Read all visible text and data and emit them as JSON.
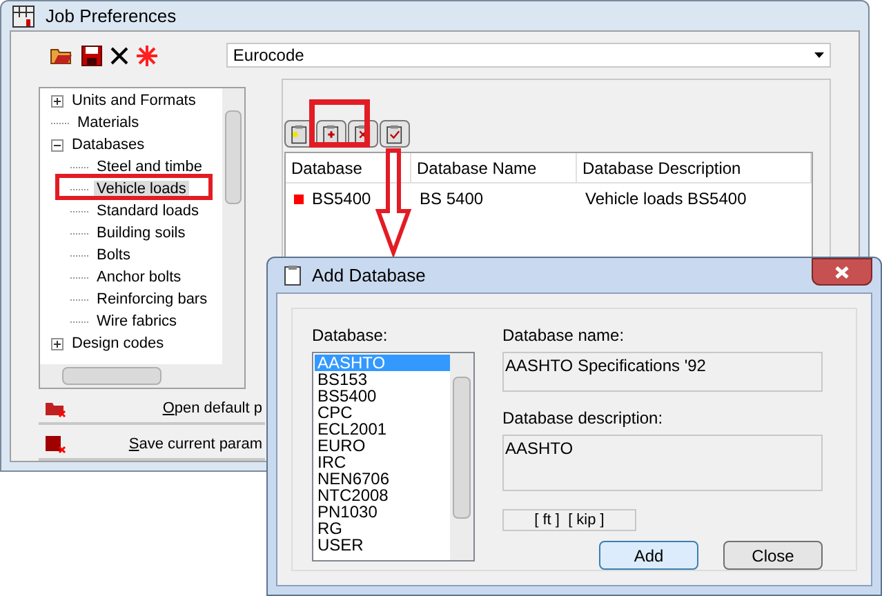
{
  "window": {
    "title": "Job Preferences"
  },
  "preset": {
    "value": "Eurocode"
  },
  "tree": [
    {
      "label": "Units and Formats",
      "expanded": false,
      "selected": false
    },
    {
      "label": "Materials",
      "selected": false
    },
    {
      "label": "Databases",
      "expanded": true,
      "selected": false,
      "children": [
        {
          "label": "Steel and timbe",
          "selected": false
        },
        {
          "label": "Vehicle loads",
          "selected": true
        },
        {
          "label": "Standard loads",
          "selected": false
        },
        {
          "label": "Building soils",
          "selected": false
        },
        {
          "label": "Bolts",
          "selected": false
        },
        {
          "label": "Anchor bolts",
          "selected": false
        },
        {
          "label": "Reinforcing bars",
          "selected": false
        },
        {
          "label": "Wire fabrics",
          "selected": false
        }
      ]
    },
    {
      "label": "Design codes",
      "expanded": false,
      "selected": false
    }
  ],
  "actions": [
    {
      "kind": "open",
      "label": "Open default p"
    },
    {
      "kind": "save",
      "label": "Save current param"
    }
  ],
  "table": {
    "columns": [
      "Database",
      "Database Name",
      "Database Description"
    ],
    "rows": [
      {
        "color": "#ff0000",
        "cells": [
          "BS5400",
          "BS 5400",
          "Vehicle loads BS5400"
        ]
      }
    ]
  },
  "dialog": {
    "title": "Add Database",
    "list_label": "Database:",
    "items": [
      {
        "label": "AASHTO",
        "selected": true
      },
      {
        "label": "BS153",
        "selected": false
      },
      {
        "label": "BS5400",
        "selected": false
      },
      {
        "label": "CPC",
        "selected": false
      },
      {
        "label": "ECL2001",
        "selected": false
      },
      {
        "label": "EURO",
        "selected": false
      },
      {
        "label": "IRC",
        "selected": false
      },
      {
        "label": "NEN6706",
        "selected": false
      },
      {
        "label": "NTC2008",
        "selected": false
      },
      {
        "label": "PN1030",
        "selected": false
      },
      {
        "label": "RG",
        "selected": false
      },
      {
        "label": "USER",
        "selected": false
      }
    ],
    "name_label": "Database name:",
    "name_value": "AASHTO Specifications '92",
    "description_label": "Database description:",
    "description_value": "AASHTO",
    "units": "[ ft ]  [ kip ]",
    "buttons": [
      "Add",
      "Close"
    ]
  }
}
